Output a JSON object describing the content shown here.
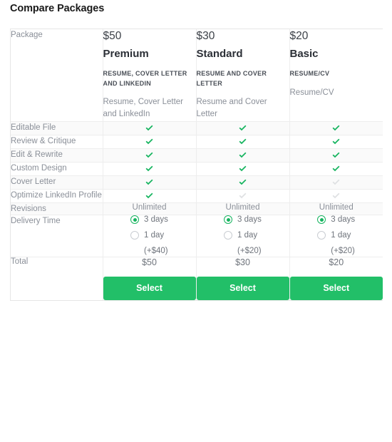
{
  "page": {
    "title": "Compare Packages"
  },
  "table": {
    "row_labels": {
      "package": "Package",
      "editable_file": "Editable File",
      "review_critique": "Review & Critique",
      "edit_rewrite": "Edit & Rewrite",
      "custom_design": "Custom Design",
      "cover_letter": "Cover Letter",
      "optimize_linkedin": "Optimize LinkedIn Profile",
      "revisions": "Revisions",
      "delivery_time": "Delivery Time",
      "total": "Total"
    },
    "packages": [
      {
        "price": "$50",
        "name": "Premium",
        "caps": "RESUME, COVER LETTER AND LINKEDIN",
        "description": "Resume, Cover Letter and LinkedIn",
        "features": {
          "editable_file": true,
          "review_critique": true,
          "edit_rewrite": true,
          "custom_design": true,
          "cover_letter": true,
          "optimize_linkedin": true
        },
        "revisions": "Unlimited",
        "delivery": {
          "options": [
            {
              "label": "3 days",
              "selected": true
            },
            {
              "label": "1 day",
              "selected": false
            }
          ],
          "surcharge": "(+$40)"
        },
        "total": "$50",
        "select_label": "Select"
      },
      {
        "price": "$30",
        "name": "Standard",
        "caps": "RESUME AND COVER LETTER",
        "description": "Resume and Cover Letter",
        "features": {
          "editable_file": true,
          "review_critique": true,
          "edit_rewrite": true,
          "custom_design": true,
          "cover_letter": true,
          "optimize_linkedin": false
        },
        "revisions": "Unlimited",
        "delivery": {
          "options": [
            {
              "label": "3 days",
              "selected": true
            },
            {
              "label": "1 day",
              "selected": false
            }
          ],
          "surcharge": "(+$20)"
        },
        "total": "$30",
        "select_label": "Select"
      },
      {
        "price": "$20",
        "name": "Basic",
        "caps": "RESUME/CV",
        "description": "Resume/CV",
        "features": {
          "editable_file": true,
          "review_critique": true,
          "edit_rewrite": true,
          "custom_design": true,
          "cover_letter": false,
          "optimize_linkedin": false
        },
        "revisions": "Unlimited",
        "delivery": {
          "options": [
            {
              "label": "3 days",
              "selected": true
            },
            {
              "label": "1 day",
              "selected": false
            }
          ],
          "surcharge": "(+$20)"
        },
        "total": "$20",
        "select_label": "Select"
      }
    ]
  },
  "colors": {
    "accent_green": "#22bf68",
    "check_green": "#16b45f",
    "check_gray": "#dfe1e3",
    "text_muted": "#8a8f98",
    "row_shade": "#fafafa"
  }
}
